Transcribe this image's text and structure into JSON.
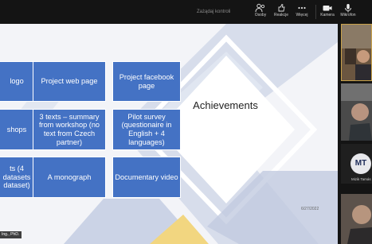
{
  "toolbar": {
    "control_request": "Zażądaj kontroli",
    "items": [
      {
        "label": "Osoby",
        "icon": "people-icon"
      },
      {
        "label": "Reakcje",
        "icon": "reactions-icon"
      },
      {
        "label": "Więcej",
        "icon": "more-icon"
      },
      {
        "label": "Kamera",
        "icon": "camera-icon"
      },
      {
        "label": "Mikrofon",
        "icon": "microphone-icon"
      }
    ]
  },
  "slide": {
    "boxes": [
      "logo",
      "Project web page",
      "Project facebook page",
      "shops",
      "3 texts – summary from workshop (no text from Czech partner)",
      "Pilot survey (questionaire in English + 4 languages)",
      "ts (4 datasets dataset)",
      "A monograph",
      "Documentary video"
    ],
    "title": "Achievements",
    "date": "6/27/2022",
    "presenter_tag": "Ing., PhD."
  },
  "participants": {
    "tile3_initials": "MT",
    "tile3_name": "Mizik Tamás"
  },
  "colors": {
    "box": "#4472c4",
    "diamond_band": "#b8c3dc",
    "accent_yellow": "#f2d680"
  }
}
